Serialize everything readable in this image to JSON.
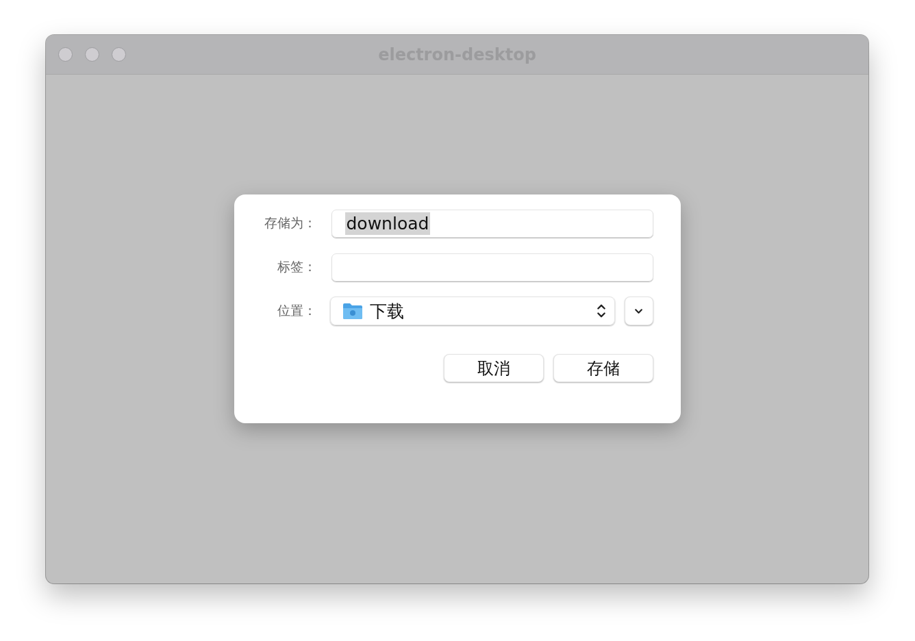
{
  "window": {
    "title": "electron-desktop"
  },
  "dialog": {
    "fields": [
      {
        "kind": "text",
        "label": "存储为：",
        "value": "download",
        "value_selected": true
      },
      {
        "kind": "text",
        "label": "标签："
      },
      {
        "kind": "popup",
        "label": "位置：",
        "value": "下载"
      }
    ],
    "buttons": [
      {
        "label": "取消"
      },
      {
        "label": "存储"
      }
    ]
  }
}
